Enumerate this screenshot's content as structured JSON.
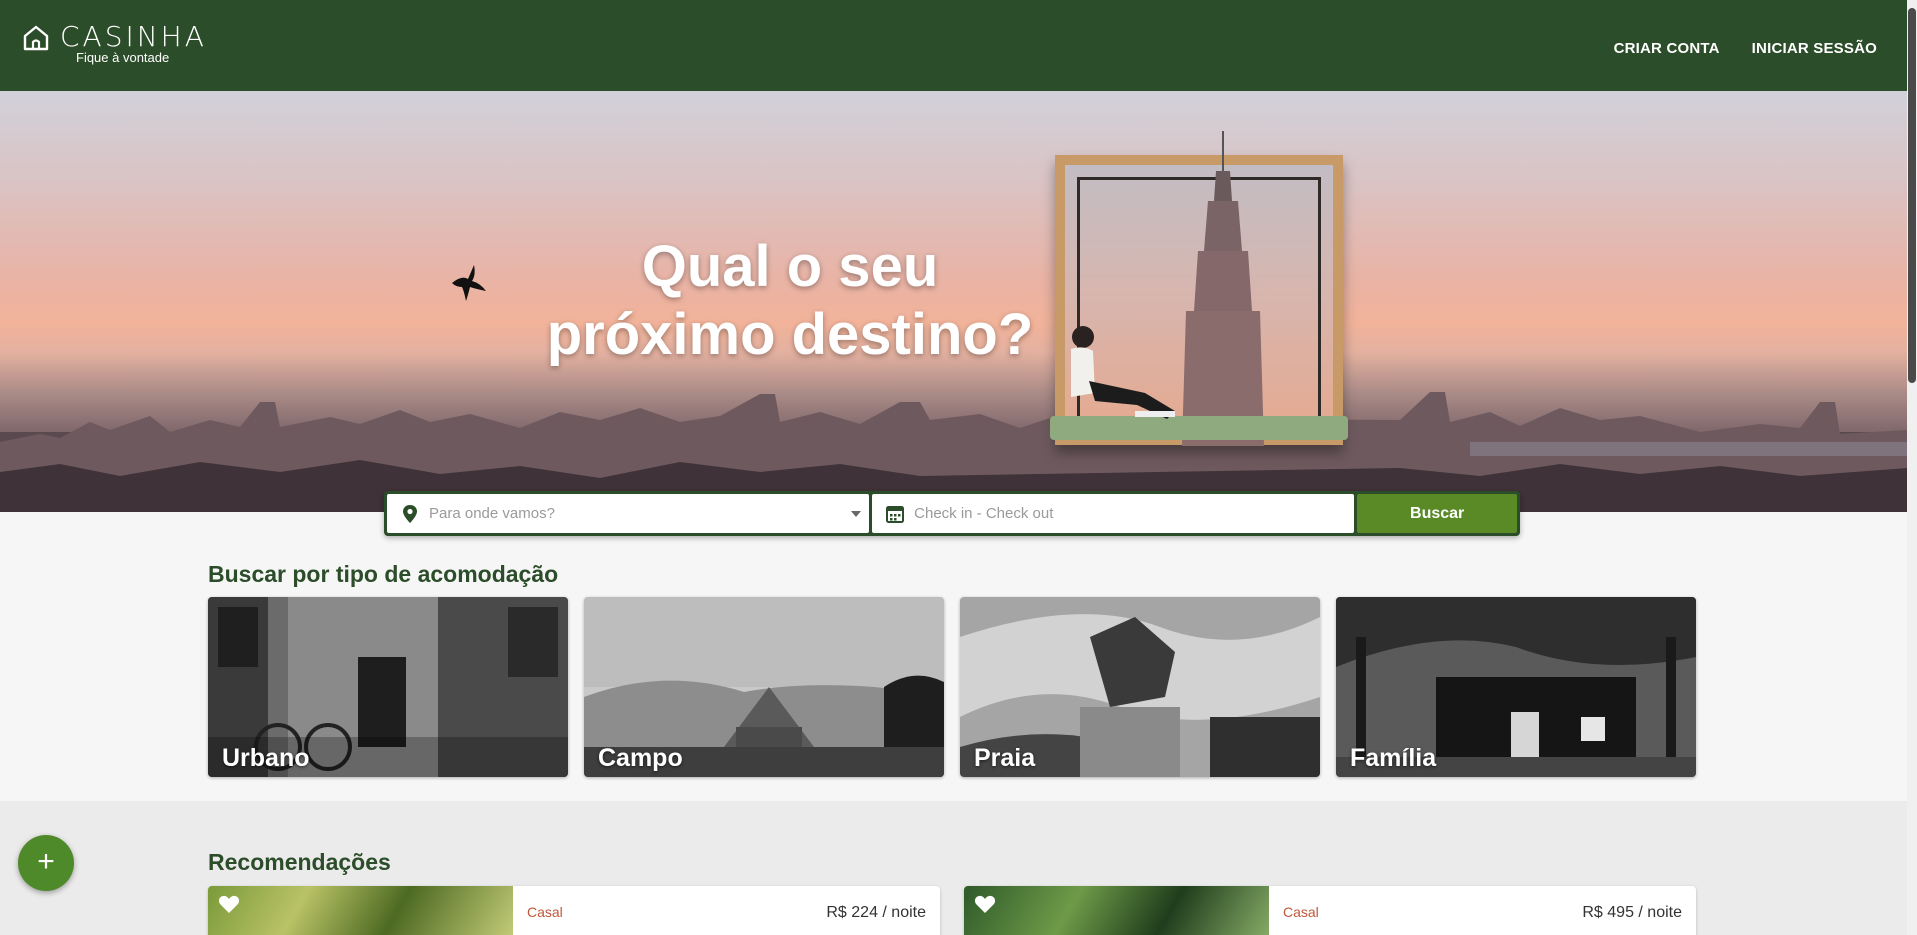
{
  "header": {
    "brand": "CASINHA",
    "slogan": "Fique à vontade",
    "nav": [
      {
        "label": "CRIAR CONTA"
      },
      {
        "label": "INICIAR SESSÃO"
      }
    ]
  },
  "hero": {
    "title_line1": "Qual o seu",
    "title_line2": "próximo destino?"
  },
  "search": {
    "where_placeholder": "Para onde vamos?",
    "dates_placeholder": "Check in - Check out",
    "button_label": "Buscar"
  },
  "types": {
    "title": "Buscar por tipo de acomodação",
    "items": [
      {
        "label": "Urbano"
      },
      {
        "label": "Campo"
      },
      {
        "label": "Praia"
      },
      {
        "label": "Família"
      }
    ]
  },
  "recommendations": {
    "title": "Recomendações",
    "items": [
      {
        "type": "Casal",
        "price": "R$ 224 / noite"
      },
      {
        "type": "Casal",
        "price": "R$ 495 / noite"
      }
    ]
  },
  "fab": {
    "label": "+"
  },
  "colors": {
    "header_bg": "#2c4d29",
    "accent_green": "#5a8a26",
    "title_green": "#2c4d29",
    "type_tag": "#c0563a"
  },
  "icons": [
    "home-icon",
    "location-pin-icon",
    "calendar-icon",
    "chevron-down-icon",
    "heart-icon",
    "plus-icon"
  ]
}
